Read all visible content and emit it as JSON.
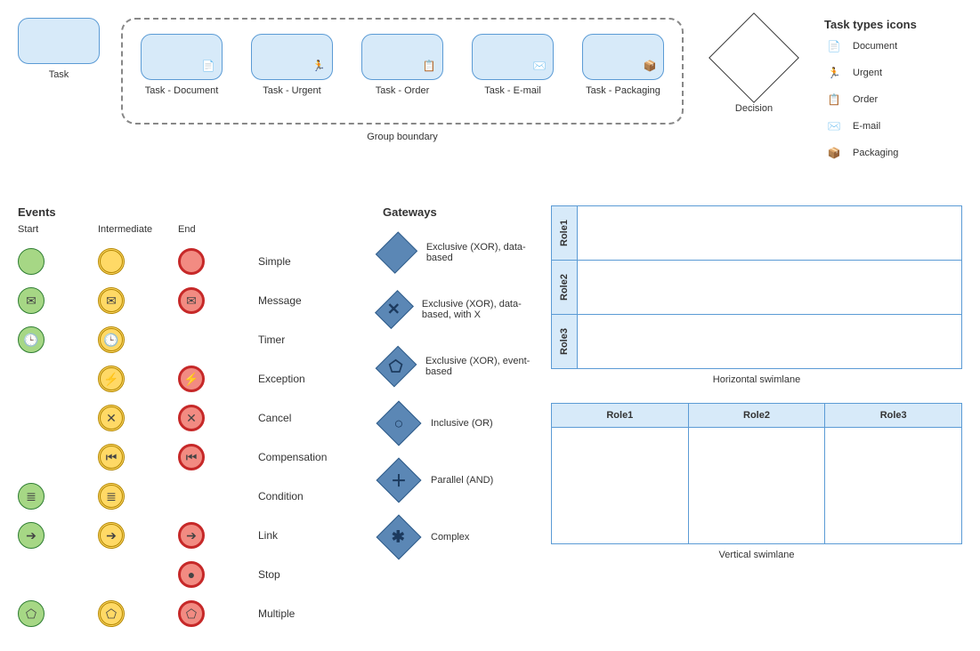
{
  "tasks": {
    "plain": "Task",
    "group_label": "Group boundary",
    "items": [
      {
        "label": "Task - Document",
        "icon": "document-icon"
      },
      {
        "label": "Task - Urgent",
        "icon": "urgent-icon"
      },
      {
        "label": "Task - Order",
        "icon": "order-icon"
      },
      {
        "label": "Task - E-mail",
        "icon": "email-icon"
      },
      {
        "label": "Task - Packaging",
        "icon": "packaging-icon"
      }
    ]
  },
  "decision_label": "Decision",
  "task_types": {
    "title": "Task types icons",
    "items": [
      {
        "label": "Document",
        "icon": "document-icon"
      },
      {
        "label": "Urgent",
        "icon": "urgent-icon"
      },
      {
        "label": "Order",
        "icon": "order-icon"
      },
      {
        "label": "E-mail",
        "icon": "email-icon"
      },
      {
        "label": "Packaging",
        "icon": "packaging-icon"
      }
    ]
  },
  "events": {
    "title": "Events",
    "columns": {
      "start": "Start",
      "intermediate": "Intermediate",
      "end": "End"
    },
    "rows": [
      {
        "name": "Simple",
        "start": true,
        "intermediate": true,
        "end": true,
        "glyph": ""
      },
      {
        "name": "Message",
        "start": true,
        "intermediate": true,
        "end": true,
        "glyph": "✉"
      },
      {
        "name": "Timer",
        "start": true,
        "intermediate": true,
        "end": false,
        "glyph": "🕒"
      },
      {
        "name": "Exception",
        "start": false,
        "intermediate": true,
        "end": true,
        "glyph": "⚡"
      },
      {
        "name": "Cancel",
        "start": false,
        "intermediate": true,
        "end": true,
        "glyph": "✕"
      },
      {
        "name": "Compensation",
        "start": false,
        "intermediate": true,
        "end": true,
        "glyph": "⏮"
      },
      {
        "name": "Condition",
        "start": true,
        "intermediate": true,
        "end": false,
        "glyph": "≣"
      },
      {
        "name": "Link",
        "start": true,
        "intermediate": true,
        "end": true,
        "glyph": "➔"
      },
      {
        "name": "Stop",
        "start": false,
        "intermediate": false,
        "end": true,
        "glyph": "●"
      },
      {
        "name": "Multiple",
        "start": true,
        "intermediate": true,
        "end": true,
        "glyph": "⬠"
      }
    ]
  },
  "gateways": {
    "title": "Gateways",
    "items": [
      {
        "label": "Exclusive (XOR), data-based",
        "glyph": ""
      },
      {
        "label": "Exclusive (XOR), data-based, with X",
        "glyph": "✕"
      },
      {
        "label": "Exclusive (XOR), event-based",
        "glyph": "⬠"
      },
      {
        "label": "Inclusive (OR)",
        "glyph": "○"
      },
      {
        "label": "Parallel (AND)",
        "glyph": "＋"
      },
      {
        "label": "Complex",
        "glyph": "✱"
      }
    ]
  },
  "swimlanes": {
    "horizontal": {
      "label": "Horizontal swimlane",
      "roles": [
        "Role1",
        "Role2",
        "Role3"
      ]
    },
    "vertical": {
      "label": "Vertical swimlane",
      "roles": [
        "Role1",
        "Role2",
        "Role3"
      ]
    }
  },
  "icon_glyphs": {
    "document-icon": "📄",
    "urgent-icon": "🏃",
    "order-icon": "📋",
    "email-icon": "✉️",
    "packaging-icon": "📦"
  }
}
